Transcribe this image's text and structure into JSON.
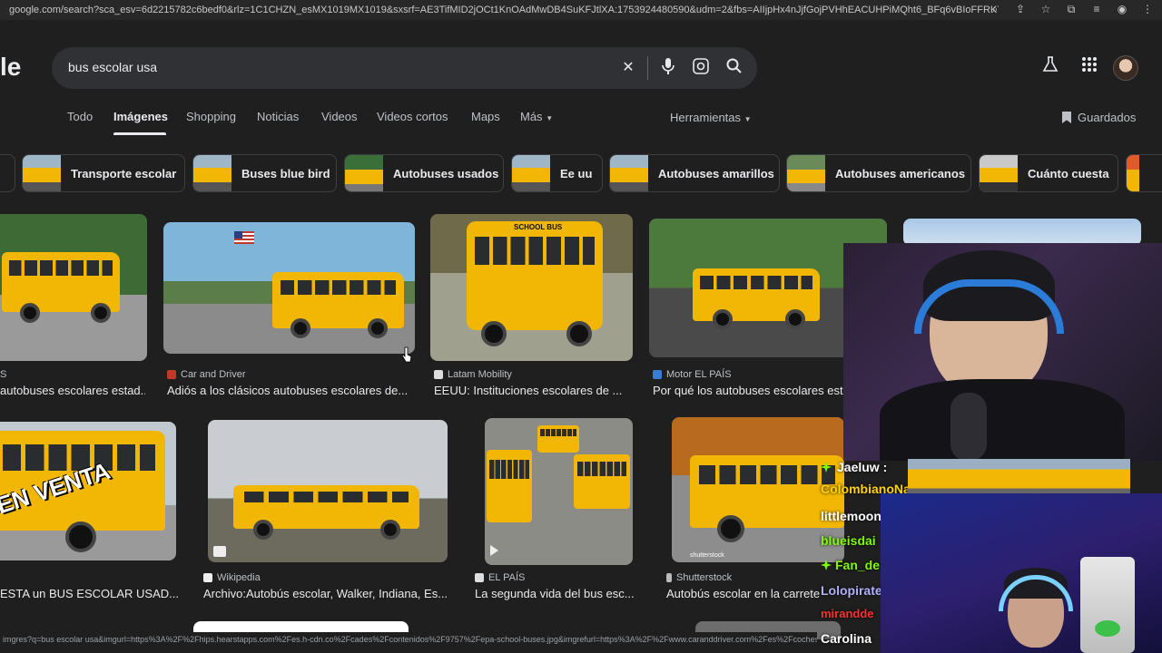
{
  "browser": {
    "url": "google.com/search?sca_esv=6d2215782c6bedf0&rlz=1C1CHZN_esMX1019MX1019&sxsrf=AE3TifMID2jOCt1KnOAdMwDB4SuKFJtlXA:1753924480590&udm=2&fbs=AIIjpHx4nJjfGojPVHhEACUHPiMQht6_BFq6vBIoFFRK7qchKG1cRgcE0P7z3SNiz..."
  },
  "search": {
    "logo_fragment": "le",
    "query": "bus escolar usa"
  },
  "tabs": [
    "Todo",
    "Imágenes",
    "Shopping",
    "Noticias",
    "Videos",
    "Videos cortos",
    "Maps",
    "Más"
  ],
  "tools": {
    "herramientas": "Herramientas",
    "guardados": "Guardados"
  },
  "chips": [
    "Transporte escolar",
    "Buses blue bird",
    "Autobuses usados",
    "Ee uu",
    "Autobuses amarillos",
    "Autobuses americanos",
    "Cuánto cuesta"
  ],
  "results": [
    {
      "source": "S",
      "caption": "autobuses escolares estad..."
    },
    {
      "source": "Car and Driver",
      "caption": "Adiós a los clásicos autobuses escolares de..."
    },
    {
      "source": "Latam Mobility",
      "caption": "EEUU: Instituciones escolares de ..."
    },
    {
      "source": "Motor EL PAÍS",
      "caption": "Por qué los autobuses escolares est"
    },
    {
      "source": "",
      "caption": "ESTA un BUS ESCOLAR USAD..."
    },
    {
      "source": "Wikipedia",
      "caption": "Archivo:Autobús escolar, Walker, Indiana, Es..."
    },
    {
      "source": "EL PAÍS",
      "caption": "La segunda vida del bus esc..."
    },
    {
      "source": "Shutterstock",
      "caption": "Autobús escolar en la carrete"
    }
  ],
  "overlay_texts": {
    "en_venta": "EN VENTA",
    "school_bus": "SCHOOL BUS",
    "shutterstock_mark": "shutterstock"
  },
  "chat": [
    {
      "name": "Jaeluw :",
      "color": "#7cfc00"
    },
    {
      "name": "ColombianoNacionalista",
      "color": "#ffd400"
    },
    {
      "name": "littlemoon",
      "color": "#ffffff"
    },
    {
      "name": "blueisdai",
      "color": "#7cfc00"
    },
    {
      "name": "Fan_de",
      "color": "#7cfc00"
    },
    {
      "name": "Lolopirate",
      "color": "#b0b0ff"
    },
    {
      "name": "mirandde",
      "color": "#ff3030"
    },
    {
      "name": "Carolina",
      "color": "#ffffff"
    }
  ],
  "status_url": "imgres?q=bus escolar usa&imgurl=https%3A%2F%2Fhips.hearstapps.com%2Fes.h-cdn.co%2Fcades%2Fcontenidos%2F9757%2Fepa-school-buses.jpg&imgrefurl=https%3A%2F%2Fwww.caranddriver.com%2Fes%2Fcoches%2Fplaneta-mo..."
}
